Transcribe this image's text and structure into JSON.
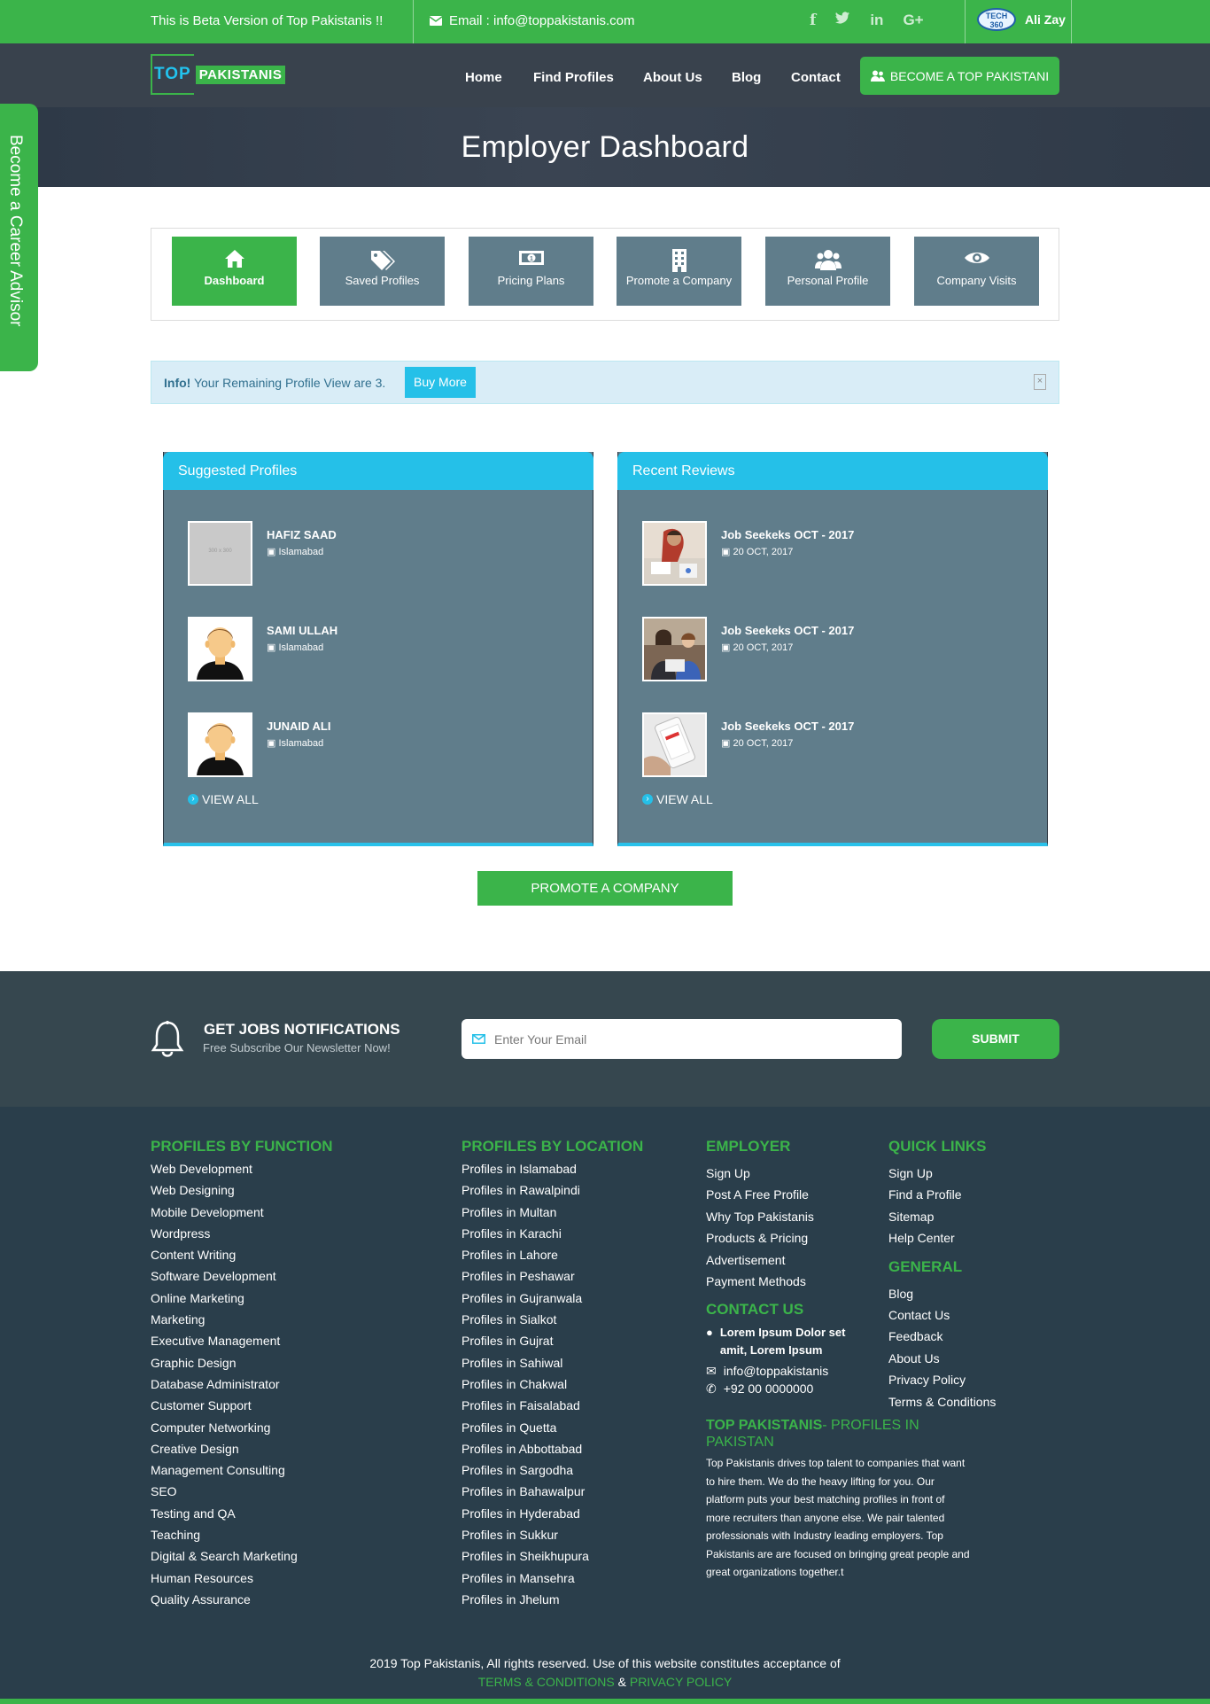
{
  "topbar": {
    "beta": "This is Beta Version of Top Pakistanis !!",
    "email": "Email : info@toppakistanis.com",
    "tech_badge": "TECH 360",
    "user": "Ali Zay",
    "social": [
      "facebook-icon",
      "twitter-icon",
      "linkedin-icon",
      "google-plus-icon"
    ]
  },
  "logo": {
    "part1": "TOP",
    "part2": "PAKISTANIS"
  },
  "nav": {
    "items": [
      "Home",
      "Find Profiles",
      "About Us",
      "Blog",
      "Contact"
    ],
    "cta": "BECOME A TOP PAKISTANI"
  },
  "hero": {
    "title": "Employer Dashboard"
  },
  "sidetab": "Become a Career Advisor",
  "tabs": [
    {
      "label": "Dashboard",
      "icon": "home-icon"
    },
    {
      "label": "Saved Profiles",
      "icon": "tags-icon"
    },
    {
      "label": "Pricing Plans",
      "icon": "money-icon"
    },
    {
      "label": "Promote a Company",
      "icon": "building-icon"
    },
    {
      "label": "Personal Profile",
      "icon": "users-icon"
    },
    {
      "label": "Company Visits",
      "icon": "eye-icon"
    }
  ],
  "info": {
    "prefix": "Info!",
    "text": "Your Remaining Profile View are 3.",
    "button": "Buy More"
  },
  "suggested": {
    "title": "Suggested Profiles",
    "items": [
      {
        "name": "HAFIZ SAAD",
        "location": "Islamabad",
        "thumb": "300 x 300"
      },
      {
        "name": "SAMI ULLAH",
        "location": "Islamabad"
      },
      {
        "name": "JUNAID ALI",
        "location": "Islamabad"
      }
    ],
    "view_all": "VIEW ALL"
  },
  "reviews": {
    "title": "Recent Reviews",
    "items": [
      {
        "title": "Job Seekeks OCT - 2017",
        "date": "20 OCT, 2017"
      },
      {
        "title": "Job Seekeks OCT - 2017",
        "date": "20 OCT, 2017"
      },
      {
        "title": "Job Seekeks OCT - 2017",
        "date": "20 OCT, 2017"
      }
    ],
    "view_all": "VIEW ALL"
  },
  "promote": "PROMOTE A COMPANY",
  "newsletter": {
    "heading": "GET JOBS NOTIFICATIONS",
    "sub": "Free Subscribe Our Newsletter Now!",
    "placeholder": "Enter Your Email",
    "button": "SUBMIT"
  },
  "footer": {
    "function": {
      "title": "PROFILES BY FUNCTION",
      "items": [
        "Web Development",
        "Web Designing",
        "Mobile Development",
        "Wordpress",
        "Content Writing",
        "Software Development",
        "Online Marketing",
        "Marketing",
        "Executive Management",
        "Graphic Design",
        "Database Administrator",
        "Customer Support",
        "Computer Networking",
        "Creative Design",
        "Management Consulting",
        "SEO",
        "Testing and QA",
        "Teaching",
        "Digital & Search Marketing",
        "Human Resources",
        "Quality Assurance"
      ]
    },
    "location": {
      "title": "PROFILES BY LOCATION",
      "items": [
        "Profiles in Islamabad",
        "Profiles in Rawalpindi",
        "Profiles in Multan",
        "Profiles in Karachi",
        "Profiles in Lahore",
        "Profiles in Peshawar",
        "Profiles in Gujranwala",
        "Profiles in Sialkot",
        "Profiles in Gujrat",
        "Profiles in Sahiwal",
        "Profiles in Chakwal",
        "Profiles in Faisalabad",
        "Profiles in Quetta",
        "Profiles in Abbottabad",
        "Profiles in Sargodha",
        "Profiles in Bahawalpur",
        "Profiles in Hyderabad",
        "Profiles in Sukkur",
        "Profiles in Sheikhupura",
        "Profiles in Mansehra",
        "Profiles in Jhelum"
      ]
    },
    "employer": {
      "title": "EMPLOYER",
      "items": [
        "Sign Up",
        "Post A Free Profile",
        "Why Top Pakistanis",
        "Products & Pricing",
        "Advertisement",
        "Payment Methods"
      ]
    },
    "contact": {
      "title": "CONTACT US",
      "address": "Lorem Ipsum Dolor set amit, Lorem Ipsum",
      "email": "info@toppakistanis",
      "phone": "+92 00 0000000"
    },
    "about": {
      "title_main": "TOP PAKISTANIS",
      "title_rest": "- PROFILES IN PAKISTAN",
      "text": "Top Pakistanis drives top talent to companies that want to hire them. We do the heavy lifting for you. Our platform puts your best matching profiles in front of more recruiters than anyone else. We pair talented professionals with Industry leading employers. Top Pakistanis are are focused on bringing great people and great organizations together.t"
    },
    "quick": {
      "title": "QUICK LINKS",
      "items": [
        "Sign Up",
        "Find a Profile",
        "Sitemap",
        "Help Center"
      ]
    },
    "general": {
      "title": "GENERAL",
      "items": [
        "Blog",
        "Contact Us",
        "Feedback",
        "About Us",
        "Privacy Policy",
        "Terms & Conditions"
      ]
    },
    "copyright": "2019 Top Pakistanis, All rights reserved. Use of this website constitutes acceptance of",
    "terms": "TERMS & CONDITIONS",
    "amp": "&",
    "privacy": "PRIVACY POLICY"
  }
}
